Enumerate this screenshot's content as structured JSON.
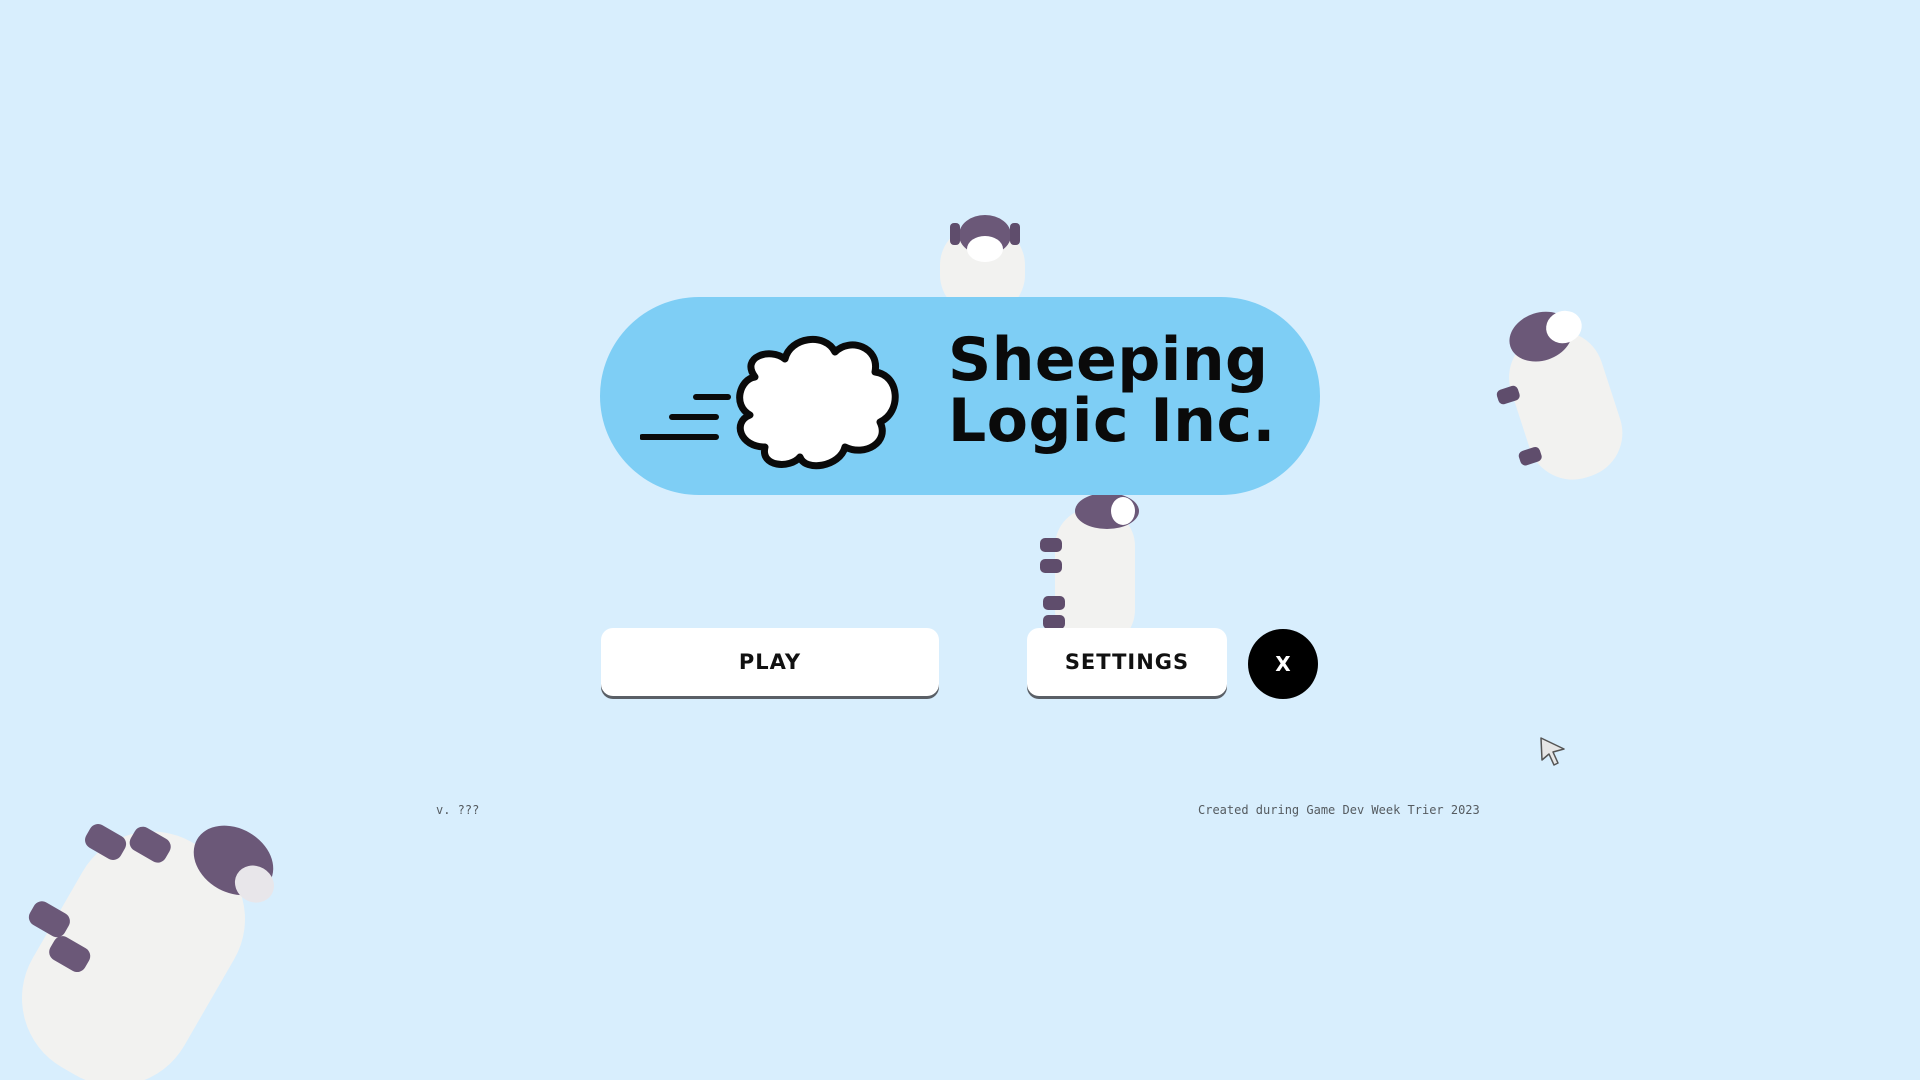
{
  "logo": {
    "line1": "Sheeping",
    "line2": "Logic Inc."
  },
  "menu": {
    "play_label": "PLAY",
    "settings_label": "SETTINGS",
    "close_label": "X"
  },
  "footer": {
    "version": "v. ???",
    "credit": "Created during Game Dev Week Trier 2023"
  },
  "colors": {
    "background": "#d8eefd",
    "logo_panel": "#7ecef5",
    "button": "#ffffff",
    "close_button": "#000000",
    "sheep_wool": "#f2f2f0",
    "sheep_head": "#6b5878"
  },
  "icons": [
    "cloud-logo-icon",
    "sheep-icon",
    "mouse-cursor-icon"
  ]
}
